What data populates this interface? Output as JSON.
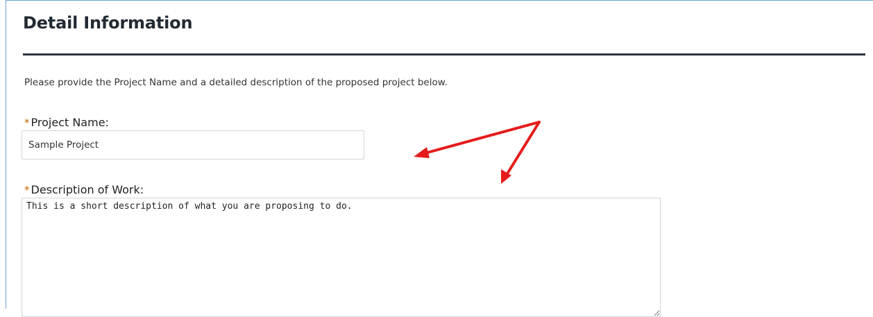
{
  "section": {
    "title": "Detail Information",
    "instructions": "Please provide the Project Name and a detailed description of the proposed project below."
  },
  "fields": {
    "required_marker": "*",
    "project_name": {
      "label": "Project Name:",
      "value": "Sample Project"
    },
    "description": {
      "label": "Description of Work:",
      "value": "This is a short description of what you are proposing to do."
    }
  },
  "annotation": {
    "arrow_color": "#e51c1c",
    "icons": [
      "arrow-to-project-name-icon",
      "arrow-to-description-icon"
    ]
  },
  "colors": {
    "frame_border": "#6d9fd6",
    "title_rule": "#2a3440",
    "required_marker": "#c26a00"
  }
}
